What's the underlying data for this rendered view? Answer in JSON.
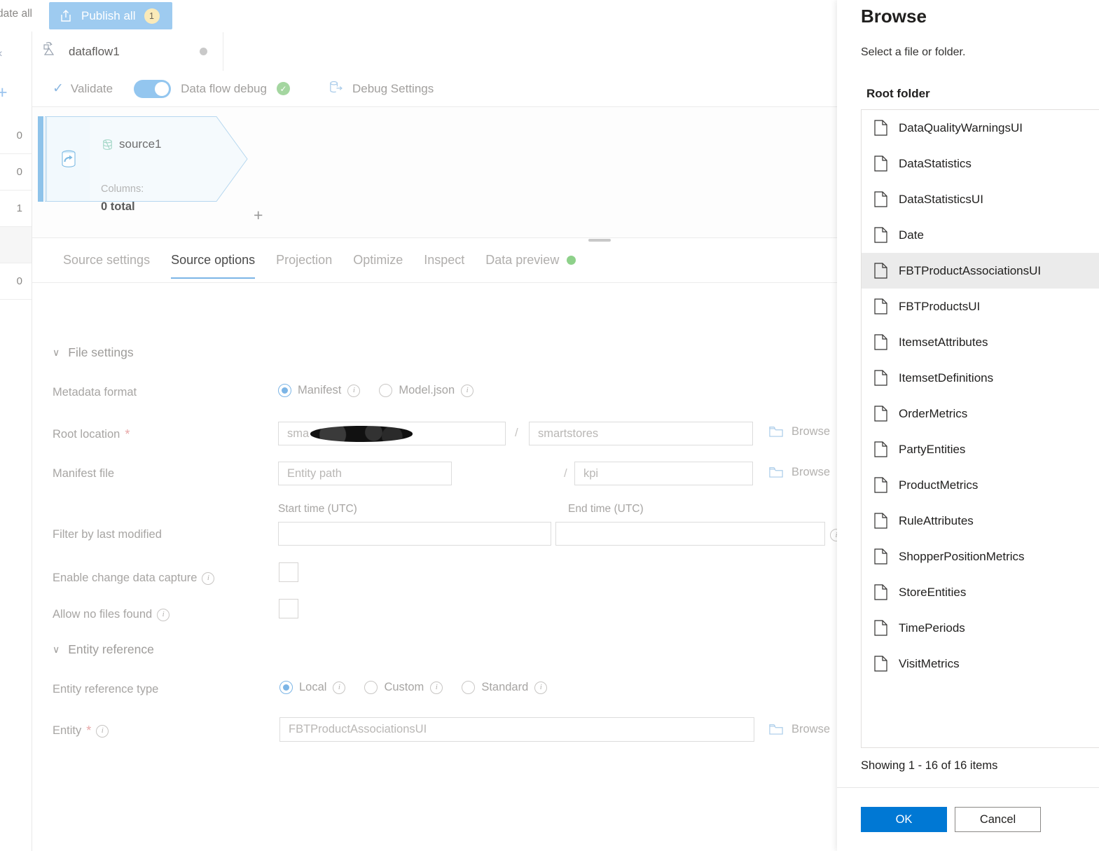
{
  "topbar": {
    "validate_all_label": "date all",
    "publish_all_label": "Publish all",
    "publish_badge": "1",
    "publish_icon": "publish-upload-icon"
  },
  "dataflow_tab": {
    "name": "dataflow1",
    "icon": "dataflow-icon",
    "unsaved_dot": "unsaved-indicator"
  },
  "debugbar": {
    "validate_label": "Validate",
    "debug_toggle_label": "Data flow debug",
    "debug_toggle_state": "on",
    "debug_status_icon": "status-success-icon",
    "debug_settings_label": "Debug Settings"
  },
  "canvas": {
    "node": {
      "name": "source1",
      "columns_label": "Columns:",
      "columns_total": "0 total",
      "add_label": "+"
    }
  },
  "left_rail": {
    "collapse_icon": "collapse-chevron-icon",
    "add_icon": "add-icon",
    "counts": [
      "0",
      "0",
      "1",
      "",
      "0"
    ]
  },
  "tabs": [
    {
      "label": "Source settings",
      "active": false
    },
    {
      "label": "Source options",
      "active": true
    },
    {
      "label": "Projection",
      "active": false
    },
    {
      "label": "Optimize",
      "active": false
    },
    {
      "label": "Inspect",
      "active": false
    },
    {
      "label": "Data preview",
      "active": false,
      "status_dot": "#8ed18a"
    }
  ],
  "form": {
    "file_settings_header": "File settings",
    "entity_reference_header": "Entity reference",
    "metadata_format": {
      "label": "Metadata format",
      "options": [
        {
          "label": "Manifest",
          "selected": true
        },
        {
          "label": "Model.json",
          "selected": false
        }
      ]
    },
    "root_location": {
      "label": "Root location",
      "required": "*",
      "container_value": "sma",
      "container_redacted": true,
      "separator": "/",
      "folder_value": "smartstores",
      "browse_label": "Browse"
    },
    "manifest_file": {
      "label": "Manifest file",
      "entity_path_placeholder": "Entity path",
      "separator": "/",
      "file_value": "kpi",
      "browse_label": "Browse"
    },
    "filter_by_last_modified": {
      "label": "Filter by last modified",
      "start_header": "Start time (UTC)",
      "end_header": "End time (UTC)",
      "start_value": "",
      "end_value": ""
    },
    "enable_cdc": {
      "label": "Enable change data capture",
      "checked": false
    },
    "allow_no_files": {
      "label": "Allow no files found",
      "checked": false
    },
    "entity_reference_type": {
      "label": "Entity reference type",
      "options": [
        {
          "label": "Local",
          "selected": true
        },
        {
          "label": "Custom",
          "selected": false
        },
        {
          "label": "Standard",
          "selected": false
        }
      ]
    },
    "entity": {
      "label": "Entity",
      "required": "*",
      "value": "FBTProductAssociationsUI",
      "browse_label": "Browse"
    }
  },
  "browse_panel": {
    "title": "Browse",
    "subtitle": "Select a file or folder.",
    "list_label": "Root folder",
    "items": [
      {
        "name": "DataQualityWarningsUI",
        "selected": false
      },
      {
        "name": "DataStatistics",
        "selected": false
      },
      {
        "name": "DataStatisticsUI",
        "selected": false
      },
      {
        "name": "Date",
        "selected": false
      },
      {
        "name": "FBTProductAssociationsUI",
        "selected": true
      },
      {
        "name": "FBTProductsUI",
        "selected": false
      },
      {
        "name": "ItemsetAttributes",
        "selected": false
      },
      {
        "name": "ItemsetDefinitions",
        "selected": false
      },
      {
        "name": "OrderMetrics",
        "selected": false
      },
      {
        "name": "PartyEntities",
        "selected": false
      },
      {
        "name": "ProductMetrics",
        "selected": false
      },
      {
        "name": "RuleAttributes",
        "selected": false
      },
      {
        "name": "ShopperPositionMetrics",
        "selected": false
      },
      {
        "name": "StoreEntities",
        "selected": false
      },
      {
        "name": "TimePeriods",
        "selected": false
      },
      {
        "name": "VisitMetrics",
        "selected": false
      }
    ],
    "showing_text": "Showing 1 - 16 of 16 items",
    "ok_label": "OK",
    "cancel_label": "Cancel"
  },
  "colors": {
    "accent_blue": "#0078d4",
    "soft_blue": "#9ecbf0",
    "tab_underline": "#7cb5e6",
    "success_green": "#8ed18a",
    "badge_yellow": "#faeab9",
    "selected_row": "#ebebeb"
  }
}
